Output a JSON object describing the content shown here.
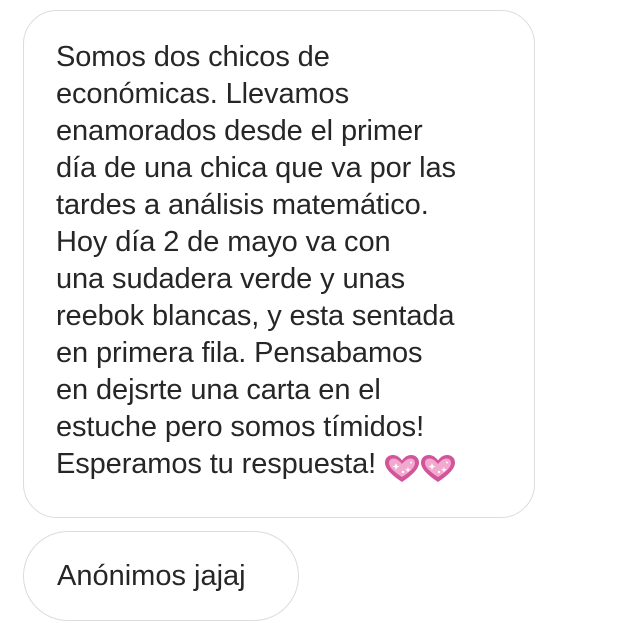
{
  "messages": [
    {
      "lines": [
        "Somos dos chicos de",
        "económicas. Llevamos",
        "enamorados desde el primer",
        "día de una chica que va por las",
        "tardes a análisis matemático.",
        "Hoy día 2 de mayo va con",
        "una sudadera verde y unas",
        "reebok blancas, y esta sentada",
        "en primera fila. Pensabamos",
        "en dejsrte una carta en el",
        "estuche pero somos tímidos!",
        "Esperamos tu respuesta!"
      ],
      "emoji": [
        "sparkling-heart-icon",
        "sparkling-heart-icon"
      ]
    },
    {
      "lines": [
        "Anónimos jajaj"
      ]
    }
  ],
  "colors": {
    "bubble_border": "#dcdcdc",
    "text": "#262626",
    "heart_fill": "#d2559a",
    "heart_light": "#f3a8cf",
    "sparkle": "#ffffff"
  }
}
